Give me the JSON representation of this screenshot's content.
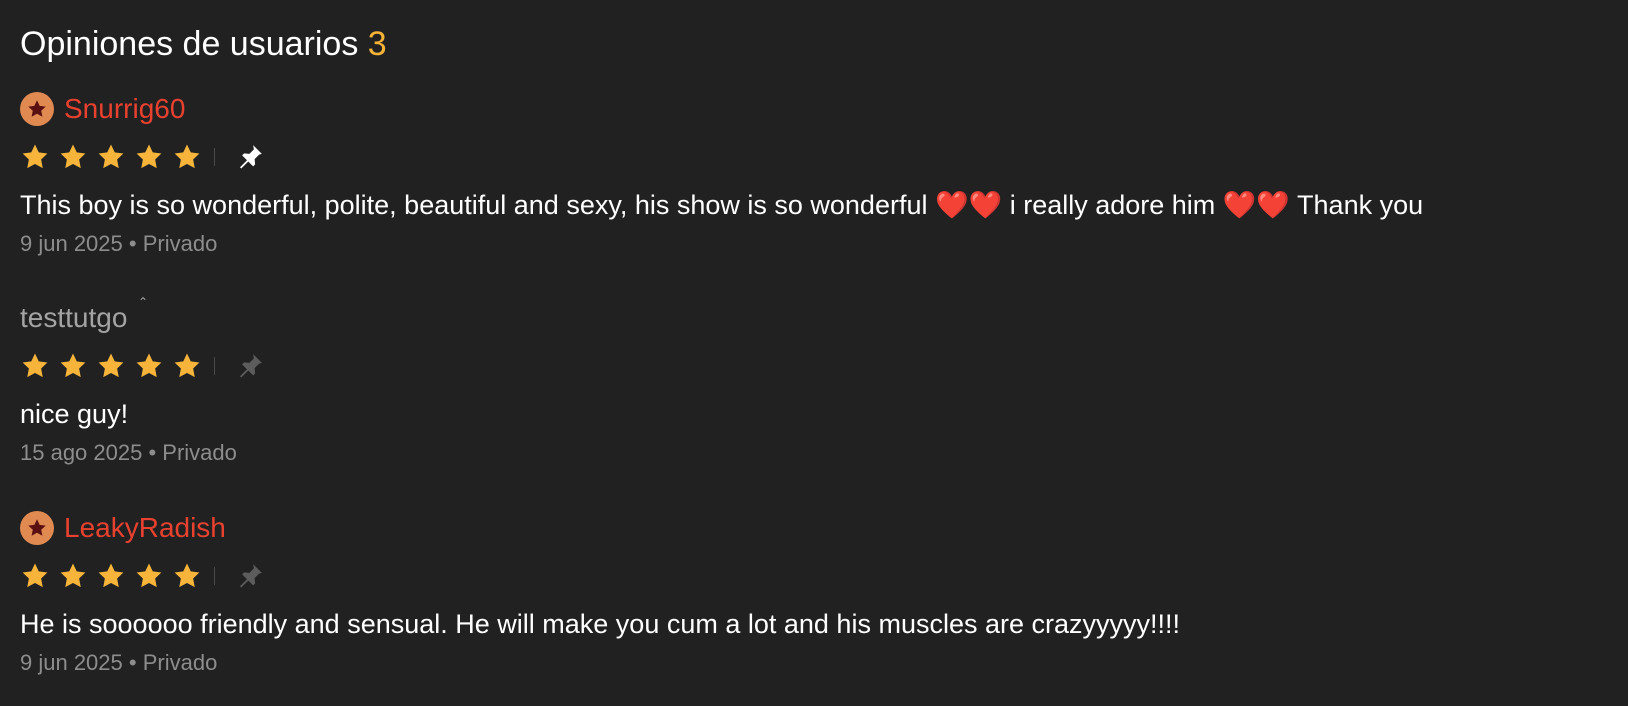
{
  "header": {
    "title": "Opiniones de usuarios",
    "count": "3"
  },
  "colors": {
    "background": "#212121",
    "accent_count": "#f5b337",
    "username_red": "#e8412f",
    "star_yellow": "#f6b53a",
    "meta_gray": "#8d8d8d"
  },
  "reviews": [
    {
      "username": "Snurrig60",
      "has_badge": true,
      "rating": 5,
      "pinned": true,
      "text": "This boy is so wonderful, polite, beautiful and sexy, his show is so wonderful ❤️❤️ i really adore him ❤️❤️ Thank you",
      "date": "9 jun 2025",
      "separator": "•",
      "visibility": "Privado"
    },
    {
      "username": "testtutgo",
      "has_badge": false,
      "rating": 5,
      "pinned": false,
      "text": "nice guy!",
      "date": "15 ago 2025",
      "separator": "•",
      "visibility": "Privado"
    },
    {
      "username": "LeakyRadish",
      "has_badge": true,
      "rating": 5,
      "pinned": false,
      "text": "He is soooooo friendly and sensual. He will make you cum a lot and his muscles are crazyyyyy!!!!",
      "date": "9 jun 2025",
      "separator": "•",
      "visibility": "Privado"
    }
  ],
  "icons": {
    "badge": "star-badge-icon",
    "rating": "star-icon",
    "pin": "pin-icon"
  }
}
